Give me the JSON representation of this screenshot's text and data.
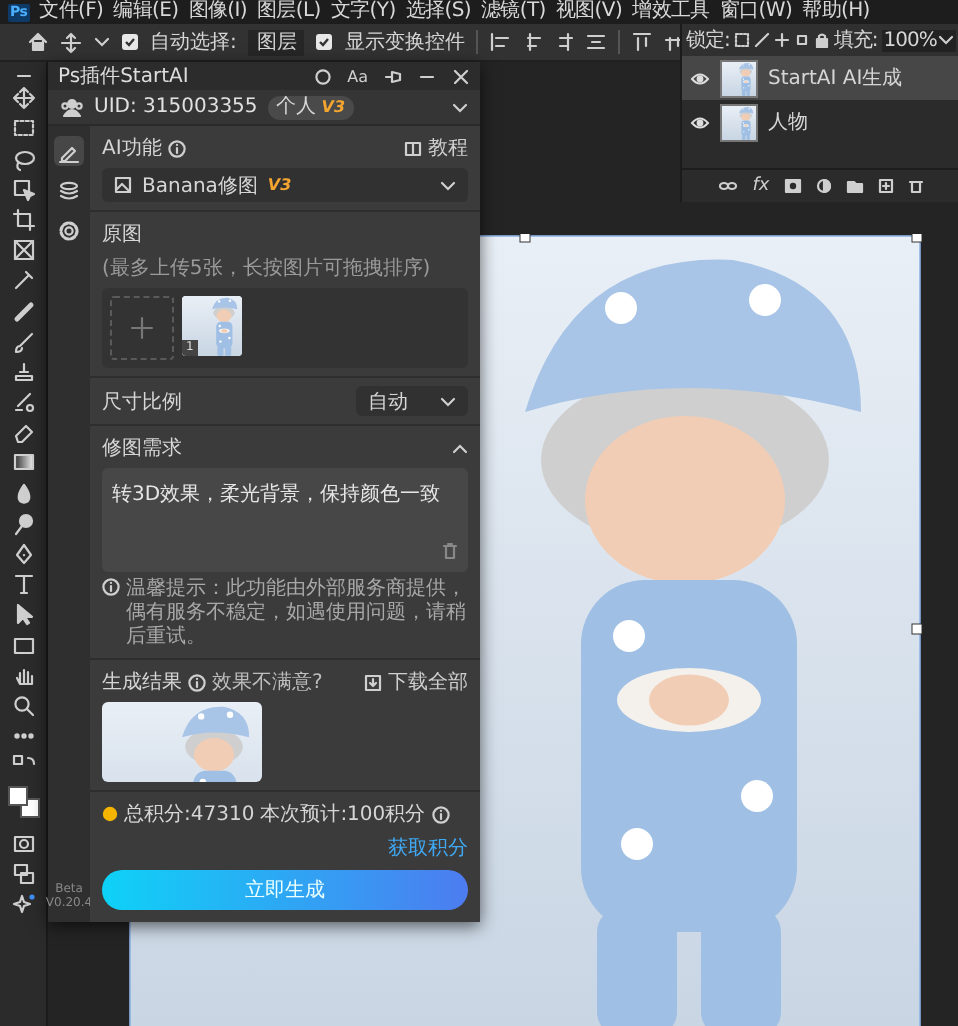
{
  "menu_bar": {
    "logo": "Ps",
    "items": [
      "文件(F)",
      "编辑(E)",
      "图像(I)",
      "图层(L)",
      "文字(Y)",
      "选择(S)",
      "滤镜(T)",
      "视图(V)",
      "增效工具",
      "窗口(W)",
      "帮助(H)"
    ]
  },
  "options_bar": {
    "auto_select": {
      "label": "自动选择:",
      "checked": true
    },
    "target": "图层",
    "transform_controls": {
      "label": "显示变换控件",
      "checked": true
    }
  },
  "layers_panel": {
    "lock_label": "锁定:",
    "fill_label": "填充:",
    "fill_value": "100%",
    "fx_label": "fx",
    "layers": [
      {
        "name": "StartAI AI生成",
        "visible": true,
        "selected": true
      },
      {
        "name": "人物",
        "visible": true,
        "selected": false
      }
    ]
  },
  "plugin": {
    "title": "Ps插件StartAI",
    "font_button": "Aa",
    "uid": "UID: 315003355",
    "plan": "个人",
    "plan_badge": "V3",
    "side_tabs": [
      {
        "selected": true
      },
      {
        "selected": false
      },
      {
        "selected": false
      }
    ],
    "version": [
      "Beta",
      "V0.20.4"
    ],
    "ai_function": {
      "label": "AI功能",
      "tutorial": "教程",
      "model": "Banana修图",
      "model_badge": "V3"
    },
    "source": {
      "label": "原图",
      "hint": "(最多上传5张，长按图片可拖拽排序)",
      "images": [
        {
          "number": "1"
        }
      ]
    },
    "aspect": {
      "label": "尺寸比例",
      "value": "自动"
    },
    "prompt": {
      "label": "修图需求",
      "expanded": true,
      "value": "转3D效果，柔光背景，保持颜色一致"
    },
    "notice": "温馨提示：此功能由外部服务商提供，偶有服务不稳定，如遇使用问题，请稍后重试。",
    "results": {
      "label": "生成结果",
      "feedback": "效果不满意?",
      "download": "下载全部"
    },
    "points": {
      "total": "总积分:47310",
      "estimate": "本次预计:100积分",
      "get": "获取积分"
    },
    "generate": "立即生成"
  }
}
